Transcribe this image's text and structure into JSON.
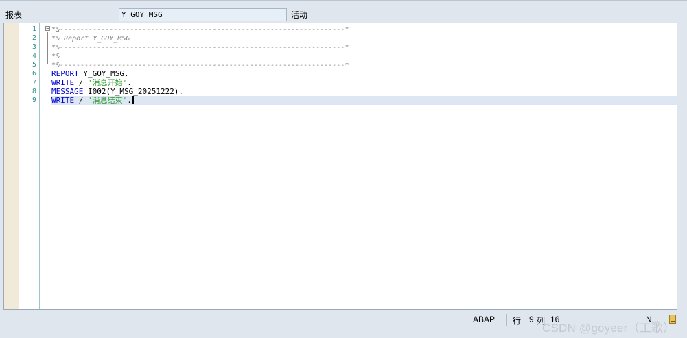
{
  "header": {
    "report_label": "报表",
    "program_name": "Y_GOY_MSG",
    "status": "活动"
  },
  "editor": {
    "line_numbers": [
      "1",
      "2",
      "3",
      "4",
      "5",
      "6",
      "7",
      "8",
      "9"
    ],
    "comments": {
      "l1": "*&---------------------------------------------------------------------*",
      "l2": "*& Report Y_GOY_MSG",
      "l3": "*&---------------------------------------------------------------------*",
      "l4": "*&",
      "l5": "*&---------------------------------------------------------------------*"
    },
    "code": {
      "l6_kw": "REPORT",
      "l6_rest": " Y_GOY_MSG.",
      "l7_kw": "WRITE",
      "l7_mid": " / ",
      "l7_str": "'消息开始'",
      "l7_end": ".",
      "l8_kw": "MESSAGE",
      "l8_rest": " I002(Y_MSG_20251222).",
      "l9_kw": "WRITE",
      "l9_mid": " / ",
      "l9_str": "'消息结束'",
      "l9_end": "."
    },
    "current_line": 9
  },
  "status_bar": {
    "language": "ABAP",
    "row_label": "行",
    "row_value": "9",
    "col_label": "列",
    "col_value": "16",
    "mode": "N..."
  },
  "watermark": "CSDN @goyeer（工歌）",
  "colors": {
    "keyword": "#0000d0",
    "string": "#2c9a2c",
    "comment": "#808080",
    "line_number": "#2d8c8c",
    "current_line_bg": "#dde7f3"
  }
}
